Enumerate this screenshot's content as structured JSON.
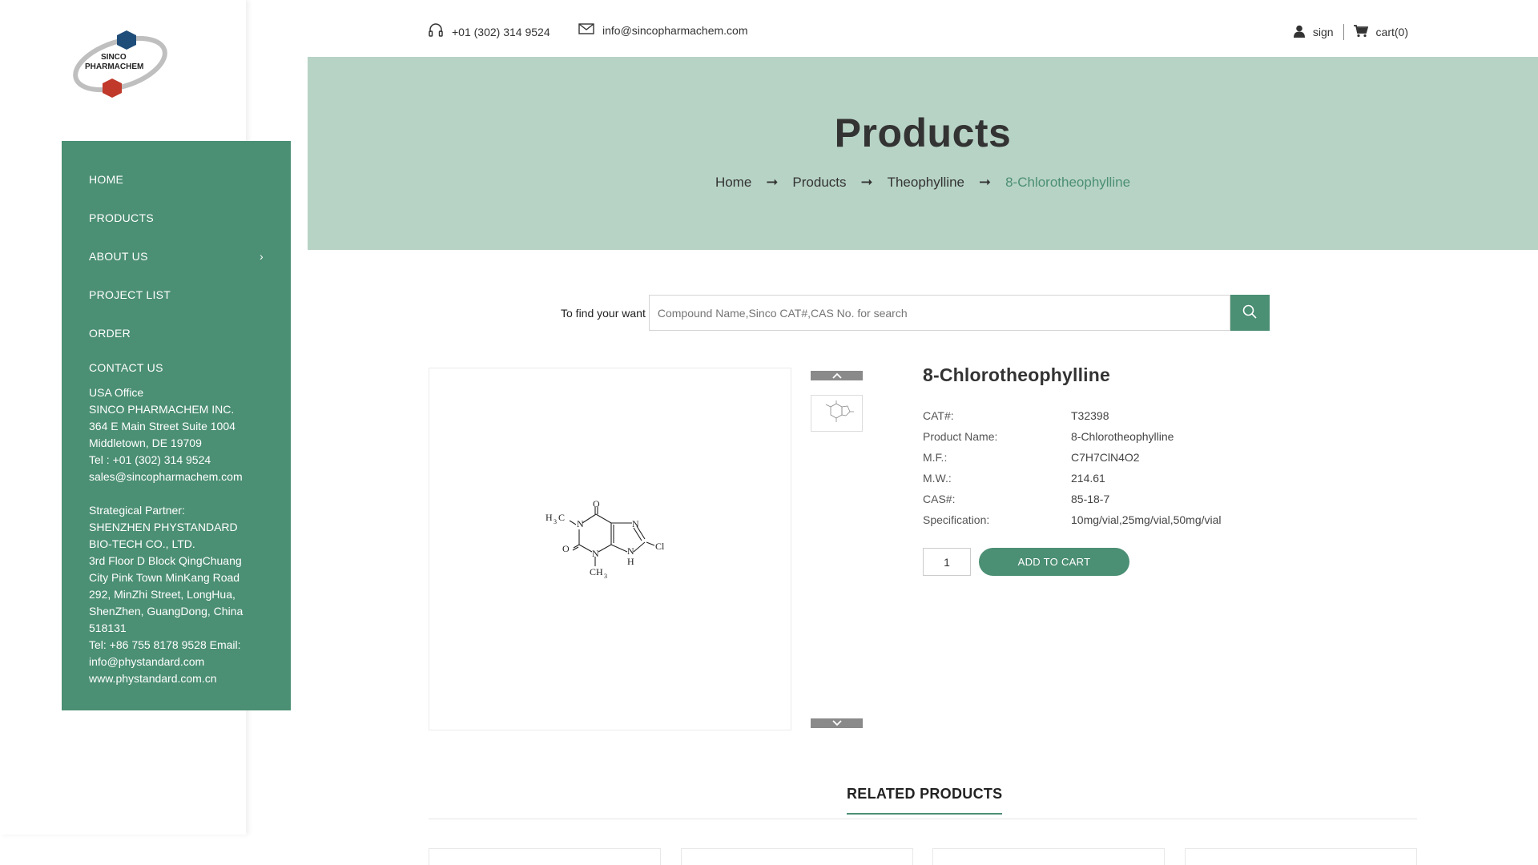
{
  "brand": {
    "logo_line1": "SINCO",
    "logo_line2": "PHARMACHEM",
    "color_primary": "#4b8f74",
    "color_hero": "#b7d3c6"
  },
  "topbar": {
    "phone": "+01 (302) 314 9524",
    "email": "info@sincopharmachem.com",
    "sign_label": "sign",
    "cart_label": "cart(0)",
    "icons": {
      "phone": "headset-icon",
      "email": "envelope-icon",
      "user": "user-icon",
      "cart": "cart-icon"
    }
  },
  "menu": {
    "items": [
      {
        "label": "HOME"
      },
      {
        "label": "PRODUCTS"
      },
      {
        "label": "ABOUT US",
        "has_submenu": true,
        "chevron": "›"
      },
      {
        "label": "PROJECT LIST"
      },
      {
        "label": "ORDER"
      },
      {
        "label": "CONTACT US"
      }
    ]
  },
  "contact": {
    "usa": [
      "USA Office",
      "SINCO PHARMACHEM INC.",
      "364 E Main Street Suite 1004",
      "Middletown, DE 19709",
      "Tel : +01 (302) 314 9524",
      "sales@sincopharmachem.com"
    ],
    "partner": [
      "Strategical Partner:",
      "SHENZHEN PHYSTANDARD",
      "BIO-TECH CO., LTD.",
      "3rd Floor D Block QingChuang",
      "City Pink Town MinKang Road",
      "292, MinZhi Street, LongHua,",
      "ShenZhen, GuangDong, China",
      "518131",
      "Tel: +86 755 8178 9528 Email:",
      "info@phystandard.com",
      "www.phystandard.com.cn"
    ]
  },
  "hero": {
    "title": "Products",
    "breadcrumb": [
      "Home",
      "Products",
      "Theophylline",
      "8-Chlorotheophylline"
    ],
    "arrow": "➞"
  },
  "search": {
    "label": "To find your want",
    "placeholder": "Compound Name,Sinco CAT#,CAS No. for search"
  },
  "structure_labels": {
    "o_top": "O",
    "o_left": "O",
    "n1": "N",
    "n3": "N",
    "n7": "N",
    "n9": "N",
    "h9": "H",
    "cl": "Cl",
    "me_top": "H",
    "me_top_sub": "3",
    "me_top_c": "C",
    "me_bot": "CH",
    "me_bot_sub": "3"
  },
  "product": {
    "name": "8-Chlorotheophylline",
    "specs": [
      {
        "key": "CAT#:",
        "value": "T32398"
      },
      {
        "key": "Product Name:",
        "value": "8-Chlorotheophylline"
      },
      {
        "key": "M.F.:",
        "value": "C7H7ClN4O2"
      },
      {
        "key": "M.W.:",
        "value": "214.61"
      },
      {
        "key": "CAS#:",
        "value": "85-18-7"
      },
      {
        "key": "Specification:",
        "value": "10mg/vial,25mg/vial,50mg/vial"
      }
    ],
    "quantity": "1",
    "add_to_cart": "ADD TO CART"
  },
  "related": {
    "title": "RELATED PRODUCTS"
  }
}
